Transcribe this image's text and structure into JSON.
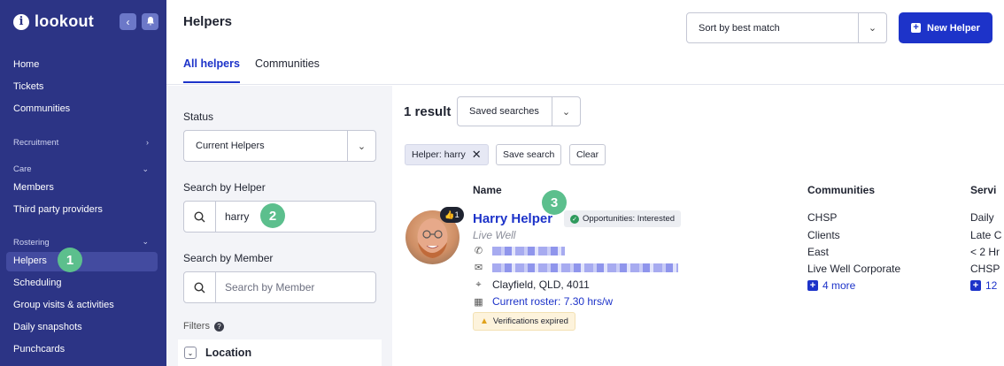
{
  "sidebar": {
    "logo_text": "lookout",
    "logo_letter": "i",
    "collapse_icon": "chevron-left-icon",
    "notif_icon": "bell-icon",
    "top_items": [
      "Home",
      "Tickets",
      "Communities"
    ],
    "section_recruitment": "Recruitment",
    "section_care": "Care",
    "care_items": [
      "Members",
      "Third party providers"
    ],
    "section_rostering": "Rostering",
    "rostering_items": [
      "Helpers",
      "Scheduling",
      "Group visits & activities",
      "Daily snapshots",
      "Punchcards"
    ],
    "active_item": "Helpers"
  },
  "header": {
    "title": "Helpers",
    "tabs": [
      "All helpers",
      "Communities"
    ],
    "active_tab": "All helpers",
    "sort_label": "Sort by best match",
    "new_button": "New Helper"
  },
  "filters": {
    "status_label": "Status",
    "status_value": "Current Helpers",
    "helper_label": "Search by Helper",
    "helper_value": "harry",
    "member_label": "Search by Member",
    "member_placeholder": "Search by Member",
    "filters_label": "Filters",
    "location_label": "Location"
  },
  "results": {
    "count": "1 result",
    "saved_searches": "Saved searches",
    "chip_filter": "Helper: harry",
    "save_search": "Save search",
    "clear": "Clear",
    "columns": [
      "Name",
      "Communities",
      "Servi"
    ]
  },
  "helper": {
    "name": "Harry Helper",
    "org": "Live Well",
    "badge": "1",
    "status": "Opportunities: Interested",
    "address": "Clayfield, QLD, 4011",
    "roster": "Current roster: 7.30 hrs/w",
    "verification": "Verifications expired",
    "communities": [
      "CHSP",
      "Clients",
      "East",
      "Live Well Corporate"
    ],
    "communities_more": "4 more",
    "services": [
      "Daily",
      "Late C",
      "< 2 Hr",
      "CHSP"
    ],
    "services_more": "12"
  },
  "annotations": [
    "1",
    "2",
    "3"
  ],
  "colors": {
    "sidebar": "#2c3485",
    "accent": "#1d33c9",
    "badge": "#5cbf8d"
  }
}
